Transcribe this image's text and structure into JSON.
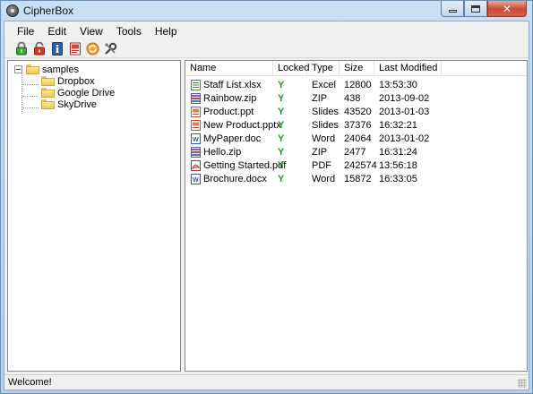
{
  "window": {
    "title": "CipherBox"
  },
  "menu": [
    "File",
    "Edit",
    "View",
    "Tools",
    "Help"
  ],
  "toolbar": [
    {
      "name": "lock-icon",
      "color": "#3aa534"
    },
    {
      "name": "unlock-icon",
      "color": "#d43a2a"
    },
    {
      "name": "info-icon",
      "color": "#2a5fb0"
    },
    {
      "name": "book-icon",
      "color": "#d04a3a"
    },
    {
      "name": "refresh-icon",
      "color": "#e88a1a"
    },
    {
      "name": "tools-icon",
      "color": "#555555"
    }
  ],
  "tree": {
    "root": "samples",
    "children": [
      "Dropbox",
      "Google Drive",
      "SkyDrive"
    ]
  },
  "columns": [
    "Name",
    "Locked",
    "Type",
    "Size",
    "Last Modified"
  ],
  "files": [
    {
      "name": "Staff List.xlsx",
      "locked": "Y",
      "type": "Excel",
      "size": "12800",
      "modified": "13:53:30",
      "icon": "excel-icon"
    },
    {
      "name": "Rainbow.zip",
      "locked": "Y",
      "type": "ZIP",
      "size": "438",
      "modified": "2013-09-02",
      "icon": "zip-icon"
    },
    {
      "name": "Product.ppt",
      "locked": "Y",
      "type": "Slides",
      "size": "43520",
      "modified": "2013-01-03",
      "icon": "slides-icon"
    },
    {
      "name": "New Product.pptx",
      "locked": "Y",
      "type": "Slides",
      "size": "37376",
      "modified": "16:32:21",
      "icon": "slides-icon"
    },
    {
      "name": "MyPaper.doc",
      "locked": "Y",
      "type": "Word",
      "size": "24064",
      "modified": "2013-01-02",
      "icon": "word-icon"
    },
    {
      "name": "Hello.zip",
      "locked": "Y",
      "type": "ZIP",
      "size": "2477",
      "modified": "16:31:24",
      "icon": "zip-icon"
    },
    {
      "name": "Getting Started.pdf",
      "locked": "Y",
      "type": "PDF",
      "size": "242574",
      "modified": "13:56:18",
      "icon": "pdf-icon"
    },
    {
      "name": "Brochure.docx",
      "locked": "Y",
      "type": "Word",
      "size": "15872",
      "modified": "16:33:05",
      "icon": "word-icon"
    }
  ],
  "status": {
    "text": "Welcome!"
  },
  "colors": {
    "locked_yes": "#1f9a1f",
    "folder": "#eec85b",
    "selection": "#3399ff"
  }
}
